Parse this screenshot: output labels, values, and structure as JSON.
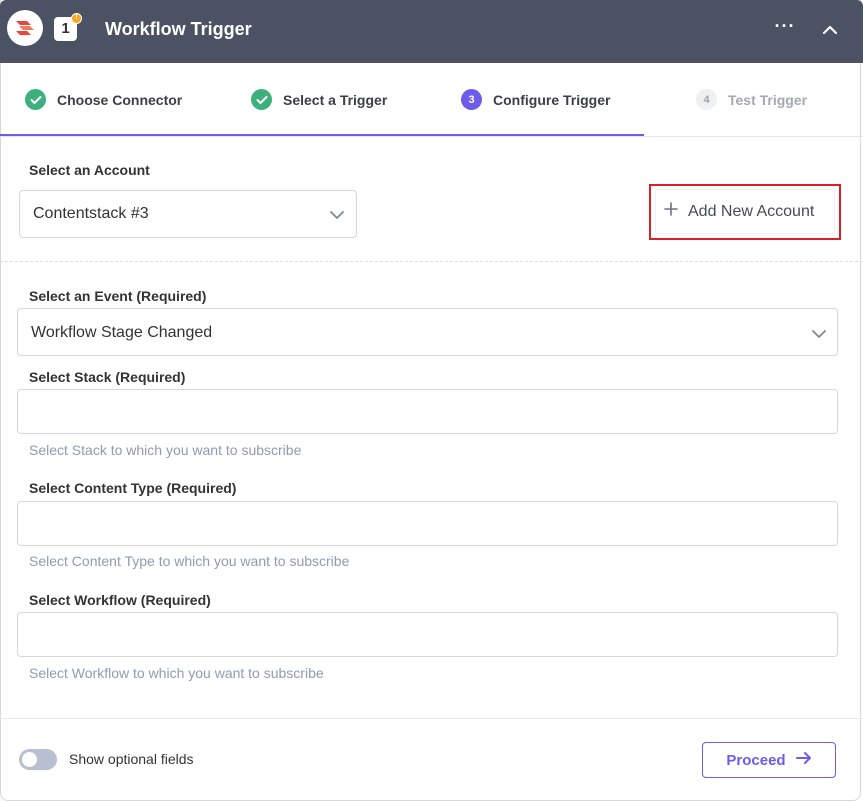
{
  "header": {
    "title": "Workflow Trigger",
    "step_number": "1",
    "notification_badge": "!",
    "more_label": "···"
  },
  "steps": [
    {
      "label": "Choose Connector",
      "status": "done",
      "number": ""
    },
    {
      "label": "Select a Trigger",
      "status": "done",
      "number": ""
    },
    {
      "label": "Configure Trigger",
      "status": "active",
      "number": "3"
    },
    {
      "label": "Test Trigger",
      "status": "pending",
      "number": "4"
    }
  ],
  "account": {
    "label": "Select an Account",
    "selected": "Contentstack #3",
    "add_button_label": "Add New Account"
  },
  "event": {
    "label": "Select an Event",
    "required": "(Required)",
    "selected": "Workflow Stage Changed"
  },
  "stack": {
    "label": "Select Stack",
    "required": "(Required)",
    "value": "",
    "help": "Select Stack to which you want to subscribe"
  },
  "content_type": {
    "label": "Select Content Type",
    "required": "(Required)",
    "value": "",
    "help": "Select Content Type to which you want to subscribe"
  },
  "workflow": {
    "label": "Select Workflow",
    "required": "(Required)",
    "value": "",
    "help": "Select Workflow to which you want to subscribe"
  },
  "footer": {
    "toggle_label": "Show optional fields",
    "toggle_on": false,
    "proceed_label": "Proceed"
  },
  "colors": {
    "header_bg": "#4a5264",
    "accent": "#6c5ce7",
    "success": "#3eb07c",
    "highlight": "#d61f26"
  },
  "icons": {
    "logo": "contentstack-logo-icon",
    "done": "check-circle-icon",
    "chevron": "chevron-down-icon",
    "plus": "plus-icon",
    "arrow": "arrow-right-icon",
    "collapse": "chevron-up-icon",
    "more": "more-horizontal-icon"
  }
}
